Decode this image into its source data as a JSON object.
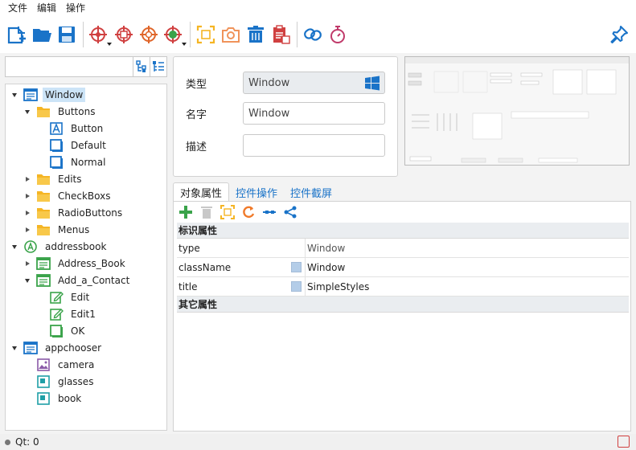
{
  "menu": [
    "文件",
    "编辑",
    "操作"
  ],
  "toolbar": {
    "groups": [
      [
        "new-file-icon",
        "open-folder-icon",
        "save-icon"
      ],
      [
        "target-add-icon",
        "target-image-icon",
        "target-code-icon",
        "qt-target-icon"
      ],
      [
        "capture-icon",
        "camera-icon",
        "trash-icon",
        "clipboard-icon"
      ],
      [
        "link-icon",
        "timer-icon"
      ]
    ]
  },
  "search": {
    "value": "",
    "placeholder": ""
  },
  "tree": [
    {
      "label": "Window",
      "icon": "window",
      "level": 0,
      "expanded": true,
      "selected": true
    },
    {
      "label": "Buttons",
      "icon": "folder",
      "level": 1,
      "expanded": true
    },
    {
      "label": "Button",
      "icon": "button-a",
      "level": 2
    },
    {
      "label": "Default",
      "icon": "button-box",
      "level": 2
    },
    {
      "label": "Normal",
      "icon": "button-box",
      "level": 2
    },
    {
      "label": "Edits",
      "icon": "folder",
      "level": 1,
      "expanded": false
    },
    {
      "label": "CheckBoxs",
      "icon": "folder",
      "level": 1,
      "expanded": false
    },
    {
      "label": "RadioButtons",
      "icon": "folder",
      "level": 1,
      "expanded": false
    },
    {
      "label": "Menus",
      "icon": "folder",
      "level": 1,
      "expanded": false
    },
    {
      "label": "addressbook",
      "icon": "app",
      "level": 0,
      "expanded": true
    },
    {
      "label": "Address_Book",
      "icon": "window-green",
      "level": 1,
      "expanded": false
    },
    {
      "label": "Add_a_Contact",
      "icon": "window-green",
      "level": 1,
      "expanded": true
    },
    {
      "label": "Edit",
      "icon": "edit",
      "level": 2
    },
    {
      "label": "Edit1",
      "icon": "edit",
      "level": 2
    },
    {
      "label": "OK",
      "icon": "button-green",
      "level": 2
    },
    {
      "label": "appchooser",
      "icon": "window",
      "level": 0,
      "expanded": true
    },
    {
      "label": "camera",
      "icon": "image",
      "level": 1
    },
    {
      "label": "glasses",
      "icon": "teal-box",
      "level": 1
    },
    {
      "label": "book",
      "icon": "teal-box",
      "level": 1
    }
  ],
  "props": {
    "type_label": "类型",
    "type_value": "Window",
    "name_label": "名字",
    "name_value": "Window",
    "desc_label": "描述",
    "desc_value": ""
  },
  "tabs": [
    "对象属性",
    "控件操作",
    "控件截屏"
  ],
  "grid": {
    "section1": "标识属性",
    "rows": [
      {
        "name": "type",
        "value": "Window",
        "swatch": false
      },
      {
        "name": "className",
        "value": "Window",
        "swatch": true
      },
      {
        "name": "title",
        "value": "SimpleStyles",
        "swatch": true
      }
    ],
    "section2": "其它属性"
  },
  "status": {
    "text": "Qt: 0"
  },
  "colors": {
    "accent": "#1a73c8",
    "folder": "#f5b524",
    "green": "#3aa34a",
    "teal": "#1f9fa6",
    "red": "#d04040"
  }
}
